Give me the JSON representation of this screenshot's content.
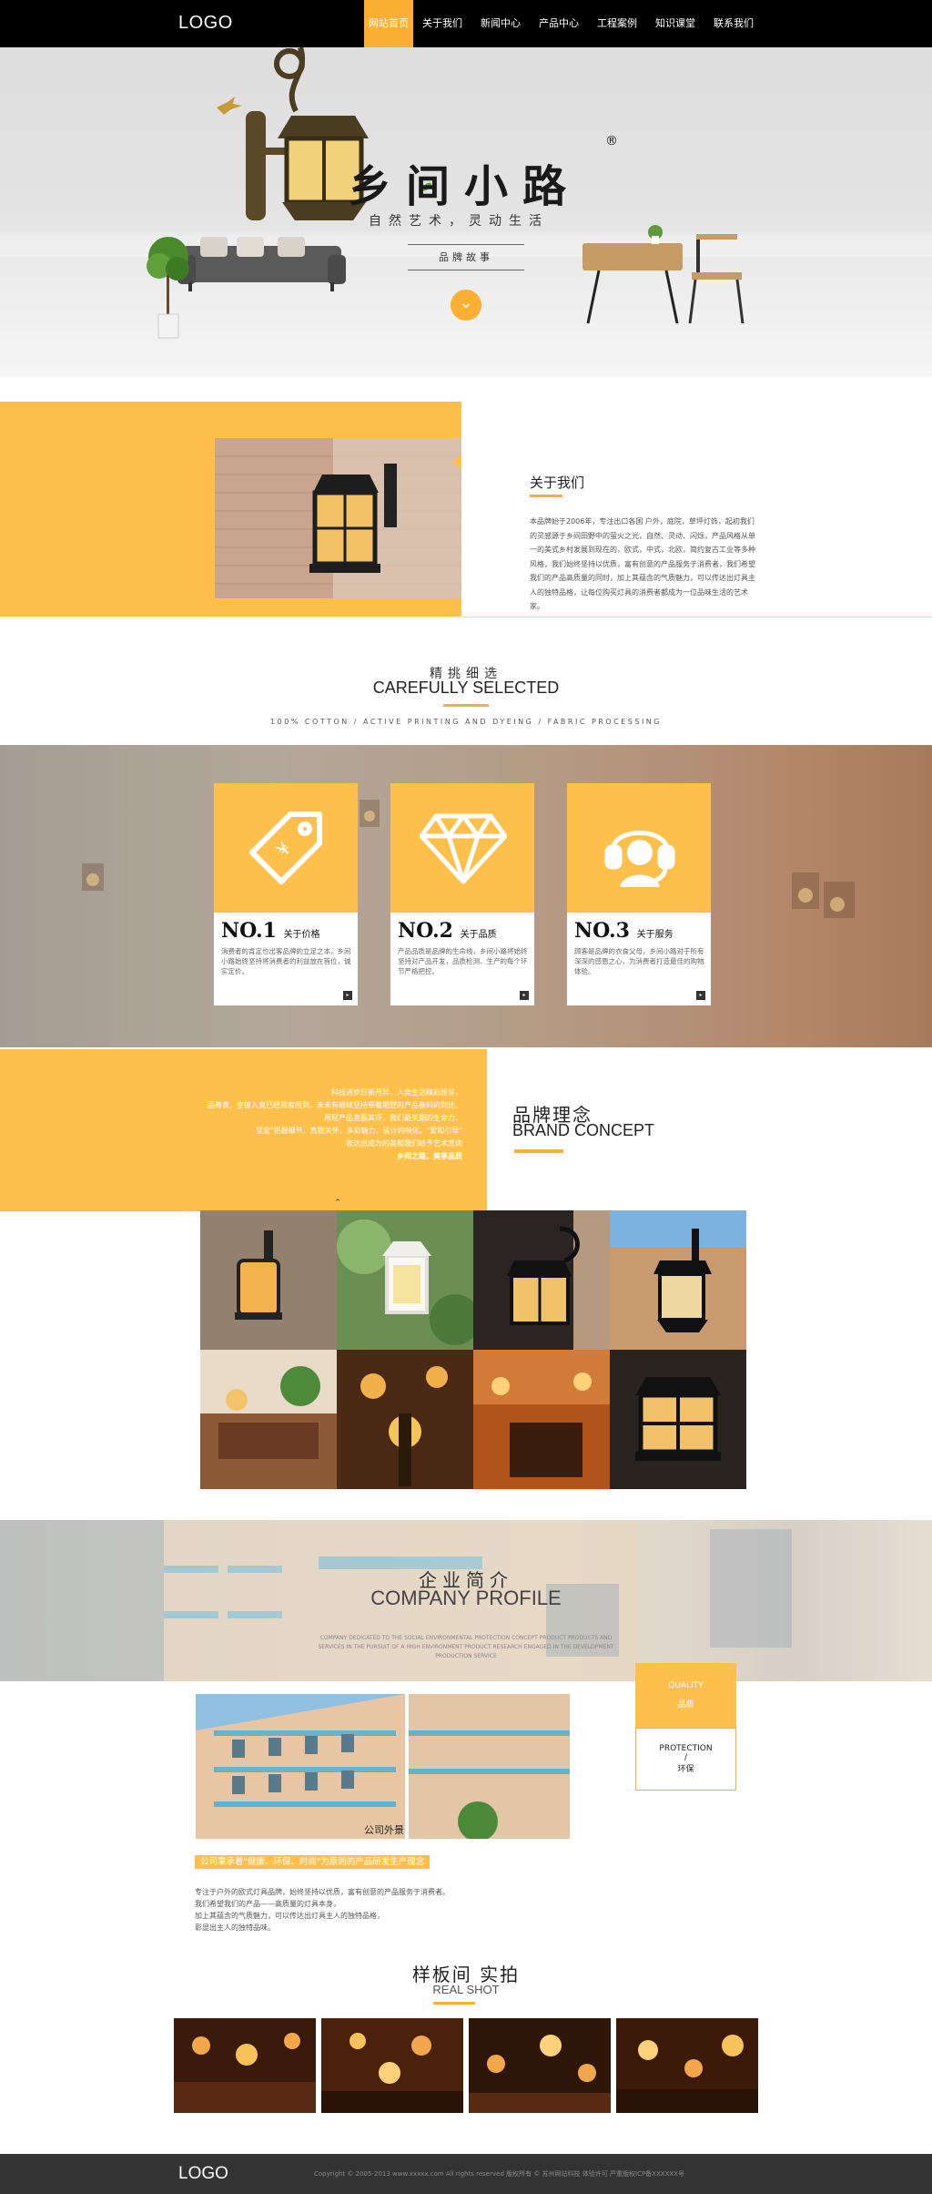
{
  "nav": {
    "logo": "LOGO",
    "items": [
      "网站首页",
      "关于我们",
      "新闻中心",
      "产品中心",
      "工程案例",
      "知识课堂",
      "联系我们"
    ],
    "active_index": 0
  },
  "hero": {
    "title": "乡间小路",
    "registered": "®",
    "subtitle": "自然艺术，灵动生活",
    "story": "品牌故事",
    "down_icon": "chevron-down-icon"
  },
  "about": {
    "title": "关于我们",
    "text": "本品牌始于2006年，专注出口各国 户外，庭院，草坪灯饰，起初我们的灵感源于乡间田野中的萤火之光，自然、灵动、闪烁，产品风格从单一的美式乡村发展到现在的，欧式，中式，北欧，简约复古工业等多种风格，我们始终坚持以优质，富有创意的产品服务于消费者，我们希望我们的产品高质量的同时，加上其蕴含的气质魅力，可以传达出灯具主人的独特品格，让每位购买灯具的消费者都成为一位品味生活的艺术家。"
  },
  "selected": {
    "title_cn": "精挑细选",
    "title_en": "CAREFULLY SELECTED",
    "tagline": "100% COTTON / ACTIVE PRINTING AND DYEING / FABRIC PROCESSING",
    "cards": [
      {
        "no": "NO.1",
        "label": "关于价格",
        "icon": "price-tag-icon",
        "desc": "消费者的肯定也出客品牌的立足之本，乡间小路始终坚持将消费者的利益放在首位，诚实定价。"
      },
      {
        "no": "NO.2",
        "label": "关于品质",
        "icon": "diamond-icon",
        "desc": "产品品质是品牌的生命线，乡间小路将始终坚持对产品开发，品质检测、生产的每个环节严格把控。"
      },
      {
        "no": "NO.3",
        "label": "关于服务",
        "icon": "customer-service-icon",
        "desc": "顾客是品牌的衣食父母，乡间小路对于所有深深的感恩之心，为消费者打造最佳的购物体验。"
      }
    ]
  },
  "brand": {
    "title_cn": "品牌理念",
    "title_en": "BRAND CONCEPT",
    "lines": [
      "科技进步日新月异，人类生活精彩纷呈，",
      "品尊表，金彼入奥已经思索很到，未未有继续坚持带着期望的产品备料的到比，",
      "用现产品直面其评，我们最关期的生命力，",
      "坚定\"把握细节，真我关怀，多彩魅力，设计的响化，\"爱和引导\"",
      "表达出成为的美和我们给予艺术真谛",
      "乡间之路，美享品质"
    ],
    "up_icon": "chevron-up-icon"
  },
  "profile": {
    "title_cn": "企业简介",
    "title_en": "COMPANY PROFILE",
    "desc": "COMPANY DEDICATED TO THE SOCIAL ENVIRONMENTAL PROTECTION CONCEPT PRODUCT PRODUCTS AND SERVICES IN THE PURSUIT OF A HIGH ENVIRONMENT PRODUCT RESEARCH ENGAGED IN THE DEVELOPMENT PRODUCTION SERVICE",
    "quality_en": "QUALITY",
    "quality_cn": "品质",
    "protection_en": "PROTECTION",
    "protection_sep": "/",
    "protection_cn": "环保",
    "photo_label": "公司外景",
    "highlight": "公司秉承着\"健康、环保、时尚\"为原则的产品研发生产理念",
    "text": [
      "专注于户外的欧式灯具品牌，始终坚持以优质，富有创意的产品服务于消费者。",
      "我们希望我们的产品——高质量的灯具本身，",
      "加上其蕴含的气质魅力，可以传达出灯具主人的独特品格，",
      "彰显出主人的独特品味。"
    ]
  },
  "real_shot": {
    "title_cn": "样板间 实拍",
    "title_en": "REAL SHOT"
  },
  "footer": {
    "logo": "LOGO",
    "copyright": "Copyright © 2005-2013 www.xxxxx.com All rights reserved 版权所有 © 苏州网站科技 体验许可 严重版权ICP备XXXXXX号"
  },
  "colors": {
    "accent": "#fbb034",
    "yellow_panel": "#fec04a",
    "nav_bg": "#000000",
    "footer_bg": "#333333"
  }
}
